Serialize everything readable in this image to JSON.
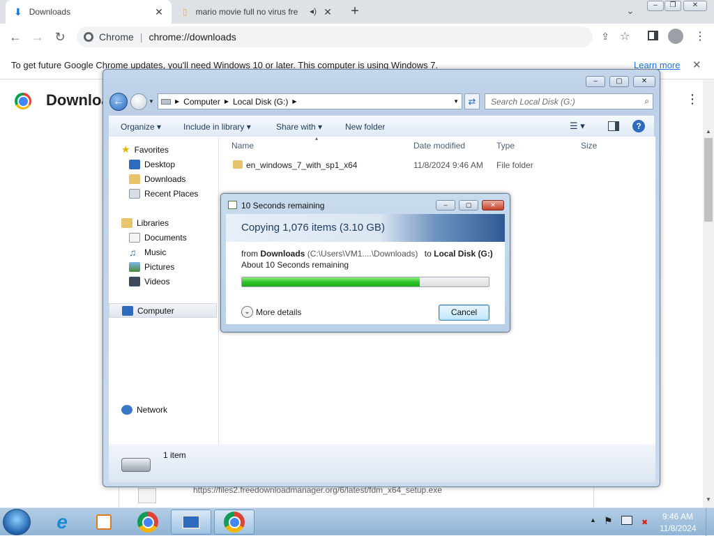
{
  "browser": {
    "tabs": [
      {
        "title": "Downloads",
        "icon": "download-icon"
      },
      {
        "title": "mario movie full no virus fre",
        "icon": "bookmark-icon"
      }
    ],
    "omnibox": {
      "scheme_label": "Chrome",
      "url": "chrome://downloads"
    },
    "infobar": {
      "message": "To get future Google Chrome updates, you'll need Windows 10 or later. This computer is using Windows 7.",
      "link": "Learn more"
    },
    "page_title": "Downloa",
    "download_url": "https://files2.freedownloadmanager.org/6/latest/fdm_x64_setup.exe"
  },
  "explorer": {
    "address": [
      "Computer",
      "Local Disk (G:)"
    ],
    "search_placeholder": "Search Local Disk (G:)",
    "commands": [
      "Organize",
      "Include in library",
      "Share with",
      "New folder"
    ],
    "nav": {
      "favorites": {
        "label": "Favorites",
        "items": [
          "Desktop",
          "Downloads",
          "Recent Places"
        ]
      },
      "libraries": {
        "label": "Libraries",
        "items": [
          "Documents",
          "Music",
          "Pictures",
          "Videos"
        ]
      },
      "computer": "Computer",
      "network": "Network"
    },
    "columns": [
      "Name",
      "Date modified",
      "Type",
      "Size"
    ],
    "rows": [
      {
        "name": "en_windows_7_with_sp1_x64",
        "date": "11/8/2024 9:46 AM",
        "type": "File folder",
        "size": ""
      }
    ],
    "status": "1 item"
  },
  "copy_dialog": {
    "title": "10 Seconds remaining",
    "heading": "Copying 1,076 items (3.10 GB)",
    "from_word": "from",
    "from_name": "Downloads",
    "from_path": "(C:\\Users\\VM1....\\Downloads)",
    "to_word": "to",
    "to_name": "Local Disk (G:)",
    "remaining": "About 10 Seconds remaining",
    "progress": 0.72,
    "more_details": "More details",
    "cancel": "Cancel"
  },
  "taskbar": {
    "time": "9:46 AM",
    "date": "11/8/2024"
  }
}
